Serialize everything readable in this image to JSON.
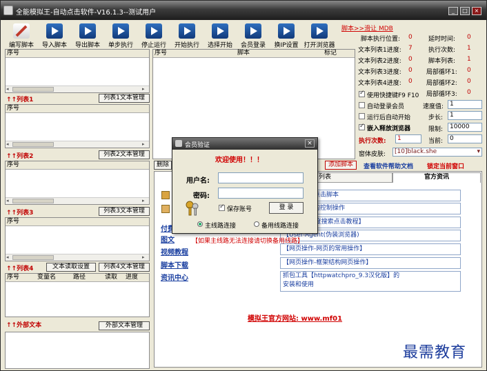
{
  "window": {
    "title": "全能模拟王-自动点击软件-V16.1.3--测试用户",
    "min": "_",
    "max": "□",
    "close": "×"
  },
  "toolbar": [
    {
      "label": "编写脚本",
      "icon": "pencil-icon",
      "color": "#c0392b"
    },
    {
      "label": "导入脚本",
      "icon": "import-arrow-icon",
      "color": "#2f6fbf"
    },
    {
      "label": "导出脚本",
      "icon": "export-arrow-icon",
      "color": "#2f6fbf"
    },
    {
      "label": "单步执行",
      "icon": "step-icon",
      "color": "#2f6fbf"
    },
    {
      "label": "停止运行",
      "icon": "pause-icon",
      "color": "#2f6fbf"
    },
    {
      "label": "开始执行",
      "icon": "play-icon",
      "color": "#2f6fbf"
    },
    {
      "label": "选择开始",
      "icon": "fast-forward-icon",
      "color": "#2f6fbf"
    },
    {
      "label": "会员登录",
      "icon": "member-icon",
      "color": "#2f6fbf"
    },
    {
      "label": "换IP设置",
      "icon": "ip-gear-icon",
      "color": "#2f6fbf"
    },
    {
      "label": "打开浏览器",
      "icon": "browser-icon",
      "color": "#2f6fbf"
    }
  ],
  "left": {
    "col_seq": "序号",
    "list1": {
      "title": "↑↑列表1",
      "btn": "列表1文本管理"
    },
    "list2": {
      "title": "↑↑列表2",
      "btn": "列表2文本管理"
    },
    "list3": {
      "title": "↑↑列表3",
      "btn": "列表3文本管理"
    },
    "list4": {
      "title": "↑↑列表4",
      "btn_read": "文本读取设置",
      "btn": "列表4文本管理",
      "cols": [
        "序号",
        "变量名",
        "路径",
        "读取",
        "进度"
      ]
    },
    "ext": {
      "title": "↑↑外部文本",
      "btn": "外部文本管理"
    }
  },
  "script_table": {
    "cols": [
      "序号",
      "脚本",
      "标记"
    ]
  },
  "right": {
    "hint": "脚本>>滑让 MDB",
    "stats": [
      {
        "label": "脚本执行位置:",
        "value": "0"
      },
      {
        "label": "延时时间:",
        "value": "0"
      },
      {
        "label": "文本列表1进度:",
        "value": "7"
      },
      {
        "label": "执行次数:",
        "value": "1"
      },
      {
        "label": "文本列表2进度:",
        "value": "0"
      },
      {
        "label": "脚本列表:",
        "value": "1"
      },
      {
        "label": "文本列表3进度:",
        "value": "0"
      },
      {
        "label": "局部循环1:",
        "value": "0"
      },
      {
        "label": "文本列表4进度:",
        "value": "0"
      },
      {
        "label": "局部循环2:",
        "value": "0"
      },
      {
        "label": "局部循环3:",
        "value": "0"
      }
    ],
    "opt_hotkey": "使用快捷键F9 F10",
    "opt_autologin": "自动登录会员",
    "opt_autostart": "运行后自动开始",
    "opt_embed": "嵌入释放浏览器",
    "speed_label": "速度值:",
    "speed_value": "1",
    "step_label": "步长:",
    "step_value": "1",
    "limit_label": "限制:",
    "limit_value": "10000",
    "exec_label": "执行次数:",
    "exec_value": "1",
    "current_label": "当前:",
    "current_value": "0",
    "skin_label": "窗体皮肤:",
    "skin_value": "[10]black.she"
  },
  "mid": {
    "delete_btn": "删除",
    "add_script": "添加脚本",
    "help_doc": "查看软件帮助文档",
    "lock_window": "锁定当前窗口",
    "tab_list": "列表",
    "tab_news": "官方资讯",
    "nav": [
      "付费",
      "图文",
      "视频教程",
      "脚本下载",
      "资讯中心"
    ],
    "news": [
      "【网页填表点击脚本",
      "【应用程序的控制操作",
      "【360SE百度搜索点击教程】",
      "【User-Agent(伪装浏览器)",
      "【网页操作-网页的常用操作】",
      "【网页操作-框架结构网页操作】",
      "抓包工具【httpwatchpro_9.3汉化版】的",
      "安装和使用"
    ],
    "site": "模拟王官方网站: www.mf01"
  },
  "dialog": {
    "title": "会员验证",
    "close": "×",
    "welcome": "欢迎使用！！！",
    "user_label": "用户名:",
    "pass_label": "密码:",
    "save_account": "保存账号",
    "login": "登 录",
    "main_line": "主线路连接",
    "backup_line": "备用线路连接",
    "hint": "【如果主线路无法连接请切换备用线路】"
  },
  "watermark": "最需教育"
}
